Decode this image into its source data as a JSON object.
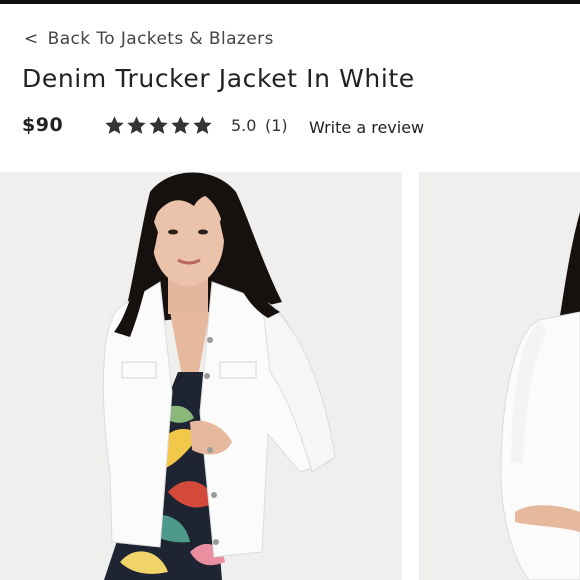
{
  "nav": {
    "back_label": "Back To Jackets & Blazers",
    "back_chevron": "<"
  },
  "product": {
    "title": "Denim Trucker Jacket In White",
    "price": "$90",
    "rating": {
      "stars": 5,
      "value": "5.0",
      "count": "(1)"
    },
    "write_review_label": "Write a review"
  },
  "gallery": {
    "images": [
      {
        "icon": "model-front-photo",
        "colors": {
          "jacket": "#fbfbfb",
          "hair": "#16110f",
          "skin": "#e9c1a8"
        }
      },
      {
        "icon": "model-side-photo"
      }
    ]
  },
  "colors": {
    "top_bar": "#111111",
    "star": "#333333",
    "image_background": "#efefee"
  }
}
